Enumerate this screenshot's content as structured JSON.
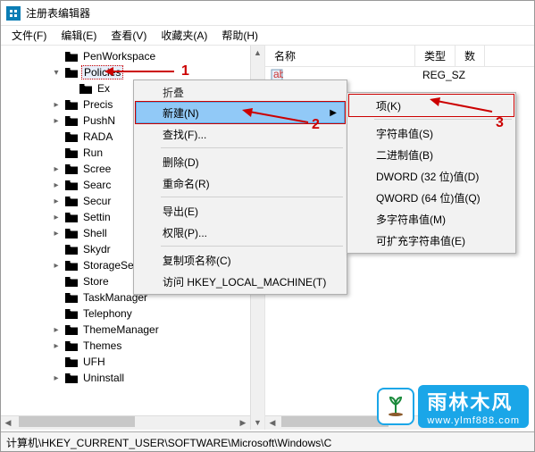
{
  "window": {
    "title": "注册表编辑器"
  },
  "menubar": [
    "文件(F)",
    "编辑(E)",
    "查看(V)",
    "收藏夹(A)",
    "帮助(H)"
  ],
  "tree": {
    "selected": "Policies",
    "items": [
      {
        "lvl": "a",
        "exp": "",
        "label": "PenWorkspace"
      },
      {
        "lvl": "a",
        "exp": "v",
        "label": "Policies",
        "selected": true
      },
      {
        "lvl": "b",
        "exp": "",
        "label": "Ex"
      },
      {
        "lvl": "a",
        "exp": ">",
        "label": "Precis"
      },
      {
        "lvl": "a",
        "exp": ">",
        "label": "PushN"
      },
      {
        "lvl": "a",
        "exp": "",
        "label": "RADA"
      },
      {
        "lvl": "a",
        "exp": "",
        "label": "Run"
      },
      {
        "lvl": "a",
        "exp": ">",
        "label": "Scree"
      },
      {
        "lvl": "a",
        "exp": ">",
        "label": "Searc"
      },
      {
        "lvl": "a",
        "exp": ">",
        "label": "Secur"
      },
      {
        "lvl": "a",
        "exp": ">",
        "label": "Settin"
      },
      {
        "lvl": "a",
        "exp": ">",
        "label": "Shell"
      },
      {
        "lvl": "a",
        "exp": "",
        "label": "Skydr"
      },
      {
        "lvl": "a",
        "exp": ">",
        "label": "StorageSense"
      },
      {
        "lvl": "a",
        "exp": "",
        "label": "Store"
      },
      {
        "lvl": "a",
        "exp": "",
        "label": "TaskManager"
      },
      {
        "lvl": "a",
        "exp": "",
        "label": "Telephony"
      },
      {
        "lvl": "a",
        "exp": ">",
        "label": "ThemeManager"
      },
      {
        "lvl": "a",
        "exp": ">",
        "label": "Themes"
      },
      {
        "lvl": "a",
        "exp": "",
        "label": "UFH"
      },
      {
        "lvl": "a",
        "exp": ">",
        "label": "Uninstall"
      }
    ]
  },
  "list": {
    "columns": [
      "名称",
      "类型",
      "数"
    ],
    "rows": [
      {
        "name": "",
        "type": "REG_SZ"
      }
    ]
  },
  "ctx1": {
    "title": "折叠",
    "items": [
      {
        "label": "新建(N)",
        "hl": true,
        "sub": true,
        "boxed": true
      },
      {
        "label": "查找(F)..."
      },
      {
        "sep": true
      },
      {
        "label": "删除(D)"
      },
      {
        "label": "重命名(R)"
      },
      {
        "sep": true
      },
      {
        "label": "导出(E)"
      },
      {
        "label": "权限(P)..."
      },
      {
        "sep": true
      },
      {
        "label": "复制项名称(C)"
      },
      {
        "label": "访问 HKEY_LOCAL_MACHINE(T)"
      }
    ]
  },
  "ctx2": {
    "items": [
      {
        "label": "项(K)",
        "boxed": true
      },
      {
        "sep": true
      },
      {
        "label": "字符串值(S)"
      },
      {
        "label": "二进制值(B)"
      },
      {
        "label": "DWORD (32 位)值(D)"
      },
      {
        "label": "QWORD (64 位)值(Q)"
      },
      {
        "label": "多字符串值(M)"
      },
      {
        "label": "可扩充字符串值(E)"
      }
    ]
  },
  "annotations": {
    "n1": "1",
    "n2": "2",
    "n3": "3"
  },
  "statusbar": "计算机\\HKEY_CURRENT_USER\\SOFTWARE\\Microsoft\\Windows\\C",
  "logo": {
    "brand": "雨林木风",
    "url": "www.ylmf888.com"
  }
}
